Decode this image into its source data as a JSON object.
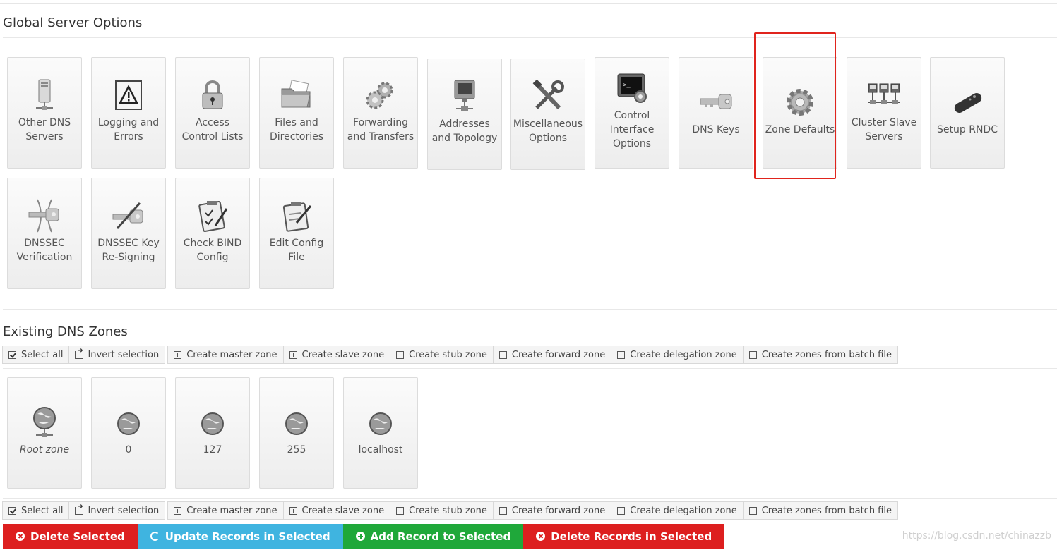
{
  "global_section": {
    "title": "Global Server Options",
    "tiles": [
      {
        "label": "Other DNS Servers",
        "icon": "server-icon"
      },
      {
        "label": "Logging and Errors",
        "icon": "warning-icon"
      },
      {
        "label": "Access Control Lists",
        "icon": "lock-icon"
      },
      {
        "label": "Files and Directories",
        "icon": "folder-icon"
      },
      {
        "label": "Forwarding and Transfers",
        "icon": "gears-icon"
      },
      {
        "label": "Addresses and Topology",
        "icon": "network-monitor-icon"
      },
      {
        "label": "Miscellaneous Options",
        "icon": "tools-icon"
      },
      {
        "label": "Control Interface Options",
        "icon": "terminal-icon"
      },
      {
        "label": "DNS Keys",
        "icon": "key-icon"
      },
      {
        "label": "Zone Defaults",
        "icon": "gear-icon"
      },
      {
        "label": "Cluster Slave Servers",
        "icon": "cluster-icon"
      },
      {
        "label": "Setup RNDC",
        "icon": "remote-control-icon"
      },
      {
        "label": "DNSSEC Verification",
        "icon": "dnssec-key-icon"
      },
      {
        "label": "DNSSEC Key Re-Signing",
        "icon": "key-pen-icon"
      },
      {
        "label": "Check BIND Config",
        "icon": "checklist-icon"
      },
      {
        "label": "Edit Config File",
        "icon": "edit-document-icon"
      }
    ]
  },
  "zones_section": {
    "title": "Existing DNS Zones",
    "zones": [
      {
        "label": "Root zone",
        "icon": "globe-server-icon"
      },
      {
        "label": "0",
        "icon": "globe-icon"
      },
      {
        "label": "127",
        "icon": "globe-icon"
      },
      {
        "label": "255",
        "icon": "globe-icon"
      },
      {
        "label": "localhost",
        "icon": "globe-icon"
      }
    ]
  },
  "toolbar": {
    "select_all": "Select all",
    "invert_selection": "Invert selection",
    "create_master": "Create master zone",
    "create_slave": "Create slave zone",
    "create_stub": "Create stub zone",
    "create_forward": "Create forward zone",
    "create_delegation": "Create delegation zone",
    "create_batch": "Create zones from batch file"
  },
  "actions": {
    "delete_selected": "Delete Selected",
    "update_records": "Update Records in Selected",
    "add_record": "Add Record to Selected",
    "delete_records": "Delete Records in Selected"
  },
  "colors": {
    "danger": "#dd1f1f",
    "info": "#3fb4e0",
    "success": "#1fa83a",
    "highlight": "#e0241d"
  },
  "watermark": "https://blog.csdn.net/chinazzb"
}
